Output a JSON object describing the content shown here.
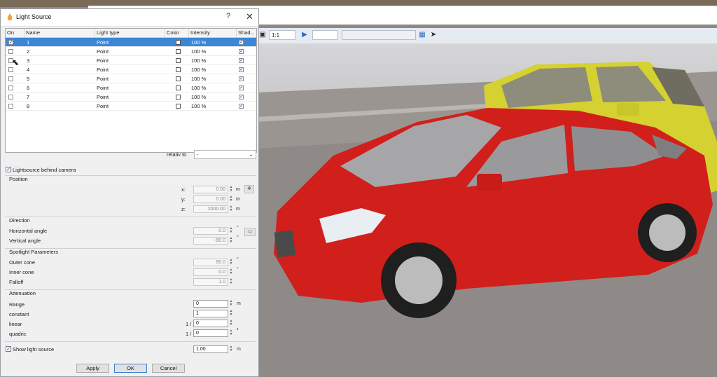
{
  "dialog": {
    "title": "Light Source",
    "help_label": "?",
    "close_label": "✕",
    "columns": [
      "On",
      "Name",
      "Light type",
      "Color",
      "Intensity",
      "Shad..."
    ],
    "rows": [
      {
        "on": true,
        "name": "1",
        "type": "Point",
        "intensity": "100 %",
        "shadow": true,
        "selected": true
      },
      {
        "on": false,
        "name": "2",
        "type": "Point",
        "intensity": "100 %",
        "shadow": true,
        "selected": false
      },
      {
        "on": false,
        "name": "3",
        "type": "Point",
        "intensity": "100 %",
        "shadow": true,
        "selected": false
      },
      {
        "on": false,
        "name": "4",
        "type": "Point",
        "intensity": "100 %",
        "shadow": true,
        "selected": false
      },
      {
        "on": false,
        "name": "5",
        "type": "Point",
        "intensity": "100 %",
        "shadow": true,
        "selected": false
      },
      {
        "on": false,
        "name": "6",
        "type": "Point",
        "intensity": "100 %",
        "shadow": true,
        "selected": false
      },
      {
        "on": false,
        "name": "7",
        "type": "Point",
        "intensity": "100 %",
        "shadow": true,
        "selected": false
      },
      {
        "on": false,
        "name": "8",
        "type": "Point",
        "intensity": "100 %",
        "shadow": true,
        "selected": false
      }
    ],
    "relativ_to": {
      "label": "relativ to",
      "value": "-"
    },
    "behind_camera": {
      "label": "Lightsource behind camera",
      "checked": true
    },
    "position": {
      "header": "Position",
      "x_label": "x:",
      "x": "0.00",
      "y_label": "y:",
      "y": "0.00",
      "z_label": "z:",
      "z": "2000.00",
      "unit": "m"
    },
    "direction": {
      "header": "Direction",
      "h_label": "Horizontal angle",
      "h": "0.0",
      "v_label": "Vertical angle",
      "v": "-90.0",
      "unit": "°"
    },
    "spotlight": {
      "header": "Spotlight Parameters",
      "outer_label": "Outer cone",
      "outer": "90.0",
      "inner_label": "Inner cone",
      "inner": "0.0",
      "falloff_label": "Falloff",
      "falloff": "1.0",
      "unit": "°"
    },
    "attenuation": {
      "header": "Attenuation",
      "range_label": "Range",
      "range": "0",
      "range_unit": "m",
      "constant_label": "constant",
      "constant": "1",
      "linear_label": "linear",
      "linear_prefix": "1 /",
      "linear": "0",
      "quadric_label": "quadric",
      "quadric_prefix": "1 /",
      "quadric": "0",
      "quadric_unit": "²"
    },
    "show_light": {
      "label": "Show light source",
      "checked": true,
      "value": "1.00",
      "unit": "m"
    },
    "buttons": {
      "apply": "Apply",
      "ok": "OK",
      "cancel": "Cancel"
    }
  },
  "toolbar": {
    "zoom": "1:1"
  },
  "colors": {
    "selection": "#3b87d6",
    "car_red": "#d11f1c",
    "car_yellow": "#d9d433"
  }
}
